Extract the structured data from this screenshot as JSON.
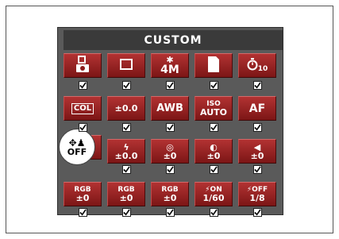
{
  "title": "CUSTOM",
  "rows": [
    {
      "cells": [
        {
          "id": "shooting-mode",
          "icon": "camera-mode-icon",
          "line1": "",
          "line2": "",
          "checked": true
        },
        {
          "id": "drive-mode",
          "icon": "single-frame-icon",
          "line1": "",
          "line2": "",
          "checked": true
        },
        {
          "id": "image-size",
          "icon": "resolution-icon",
          "line1": "4M",
          "line2": "",
          "checked": true
        },
        {
          "id": "memory-card",
          "icon": "sd-card-icon",
          "line1": "",
          "line2": "",
          "checked": true
        },
        {
          "id": "self-timer",
          "icon": "timer-icon",
          "line1": "10",
          "line2": "",
          "checked": true
        }
      ]
    },
    {
      "cells": [
        {
          "id": "color-mode",
          "icon": "",
          "line1": "COL",
          "line2": "",
          "checked": true
        },
        {
          "id": "exposure-comp",
          "icon": "",
          "line1": "±0.0",
          "line2": "",
          "checked": true
        },
        {
          "id": "white-balance",
          "icon": "",
          "line1": "AWB",
          "line2": "",
          "checked": true
        },
        {
          "id": "iso",
          "icon": "",
          "line1": "ISO",
          "line2": "AUTO",
          "checked": true
        },
        {
          "id": "focus-mode",
          "icon": "",
          "line1": "AF",
          "line2": "",
          "checked": true
        }
      ]
    },
    {
      "cells": [
        {
          "id": "af-target",
          "icon": "af-target-icon",
          "line1": "OFF",
          "line2": "",
          "checked": false,
          "selected": true
        },
        {
          "id": "flash-comp",
          "icon": "flash-icon",
          "line1": "±0.0",
          "line2": "",
          "checked": true
        },
        {
          "id": "saturation",
          "icon": "saturation-icon",
          "line1": "±0",
          "line2": "",
          "checked": true
        },
        {
          "id": "contrast",
          "icon": "contrast-icon",
          "line1": "±0",
          "line2": "",
          "checked": true
        },
        {
          "id": "sharpness",
          "icon": "sharpness-icon",
          "line1": "±0",
          "line2": "",
          "checked": true
        }
      ]
    },
    {
      "cells": [
        {
          "id": "rgb-red",
          "icon": "",
          "line1": "RGB",
          "line2": "±0",
          "checked": true
        },
        {
          "id": "rgb-green",
          "icon": "",
          "line1": "RGB",
          "line2": "±0",
          "checked": true
        },
        {
          "id": "rgb-blue",
          "icon": "",
          "line1": "RGB",
          "line2": "±0",
          "checked": true
        },
        {
          "id": "flash-on-sync",
          "icon": "",
          "line1": "⚡ON",
          "line2": "1/60",
          "checked": true
        },
        {
          "id": "flash-off-sync",
          "icon": "",
          "line1": "⚡OFF",
          "line2": "1/8",
          "checked": true
        }
      ]
    }
  ],
  "colors": {
    "cell_red": "#9c2222",
    "panel": "#5a5a5a",
    "title_bar": "#3a3a3a"
  }
}
